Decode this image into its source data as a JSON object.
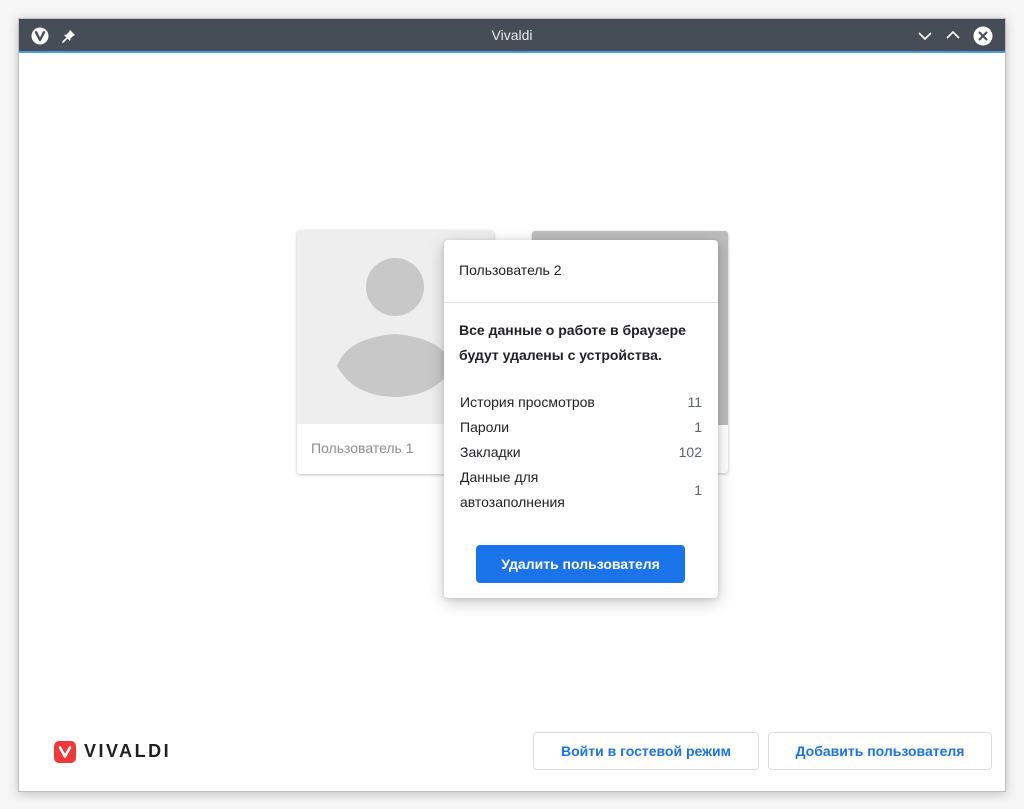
{
  "window": {
    "title": "Vivaldi"
  },
  "profiles": [
    {
      "name": "Пользователь 1"
    }
  ],
  "delete_popover": {
    "profile_name": "Пользователь 2",
    "warning": "Все данные о работе в браузере будут удалены с устройства.",
    "stats": [
      {
        "label": "История просмотров",
        "count": "11"
      },
      {
        "label": "Пароли",
        "count": "1"
      },
      {
        "label": "Закладки",
        "count": "102"
      },
      {
        "label": "Данные для автозаполнения",
        "count": "1"
      }
    ],
    "delete_button": "Удалить пользователя"
  },
  "footer": {
    "logo_text": "VIVALDI",
    "guest_button": "Войти в гостевой режим",
    "add_button": "Добавить пользователя"
  },
  "colors": {
    "titlebar": "#474d57",
    "accent": "#1a73e8",
    "brand_red": "#ef3939"
  }
}
